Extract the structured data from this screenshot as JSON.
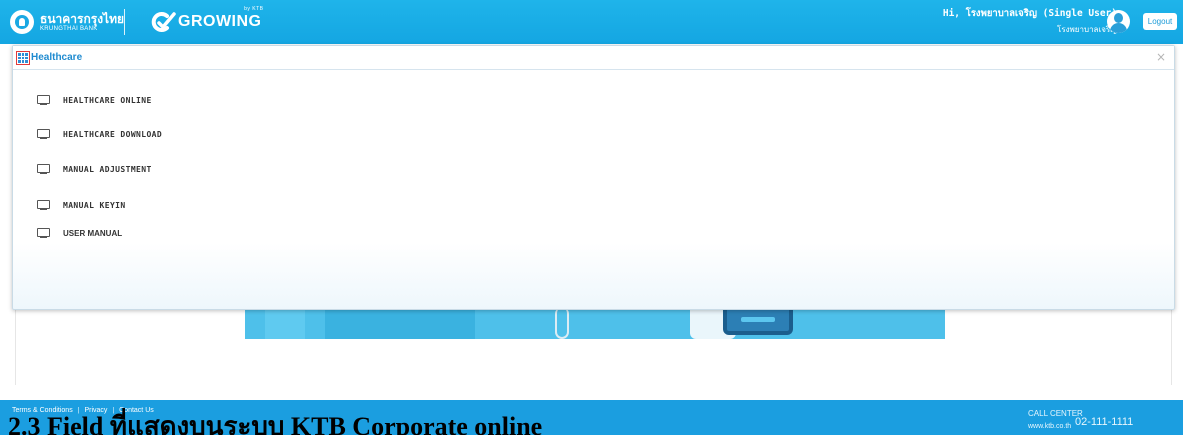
{
  "header": {
    "bank_name_thai": "ธนาคารกรุงไทย",
    "bank_name_eng": "KRUNGTHAI BANK",
    "growing_logo_text": "GROWING",
    "growing_by": "by KTB",
    "user_greeting": "Hi, โรงพยาบาลเจริญ (Single User)",
    "user_org": "โรงพยาบาลเจริญ",
    "logout_label": "Logout",
    "colors": {
      "bar": "#1aabe6",
      "accent": "#1f8bd0"
    }
  },
  "modal": {
    "title": "Healthcare",
    "close_label": "×",
    "icon": "grid-icon",
    "items": [
      {
        "label": "HEALTHCARE ONLINE",
        "icon": "monitor-icon"
      },
      {
        "label": "HEALTHCARE DOWNLOAD",
        "icon": "monitor-icon"
      },
      {
        "label": "MANUAL ADJUSTMENT",
        "icon": "monitor-icon"
      },
      {
        "label": "MANUAL KEYIN",
        "icon": "monitor-icon"
      },
      {
        "label": "USER MANUAL",
        "icon": "monitor-icon"
      }
    ]
  },
  "footer": {
    "links": [
      "Terms & Conditions",
      "|",
      "Privacy",
      "|",
      "Contact Us"
    ],
    "call_center_label": "CALL CENTER",
    "call_center_number": "02-111-1111",
    "website": "www.ktb.co.th"
  },
  "document": {
    "heading": "2.3 Field ที่แสดงบนระบบ KTB Corporate online"
  }
}
